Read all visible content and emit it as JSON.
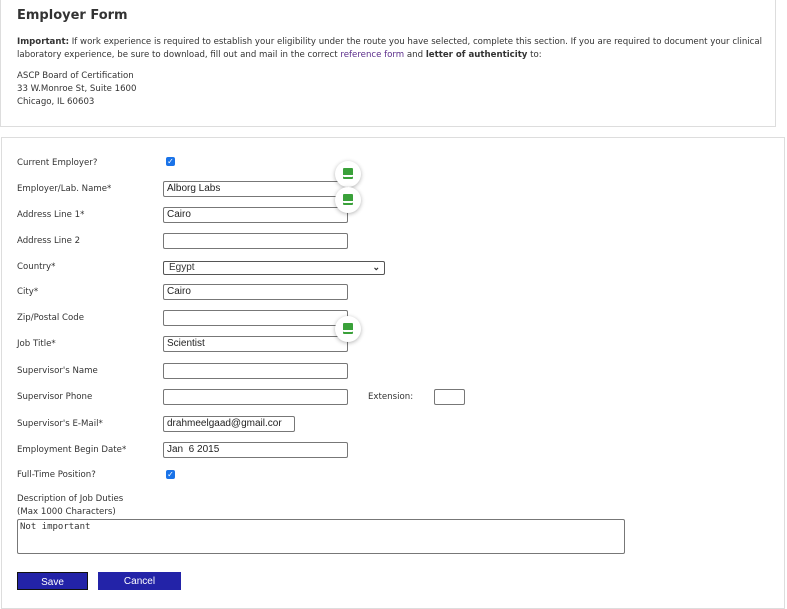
{
  "header": {
    "title": "Employer Form",
    "important_label": "Important:",
    "intro_1": " If work experience is required to establish your eligibility under the route you have selected, complete this section. If you are required to document your clinical laboratory experience, be sure to download, fill out and mail in the correct ",
    "reference_link": "reference form",
    "intro_2": " and ",
    "letter": "letter of authenticity",
    "intro_3": " to:",
    "address": [
      "ASCP Board of Certification",
      "33 W.Monroe St, Suite 1600",
      "Chicago, IL 60603"
    ]
  },
  "form": {
    "current_employer": {
      "label": "Current Employer?",
      "checked": true
    },
    "employer_name": {
      "label": "Employer/Lab. Name*",
      "value": "Alborg Labs"
    },
    "address1": {
      "label": "Address Line 1*",
      "value": "Cairo"
    },
    "address2": {
      "label": "Address Line 2",
      "value": ""
    },
    "country": {
      "label": "Country*",
      "value": "Egypt"
    },
    "city": {
      "label": "City*",
      "value": "Cairo"
    },
    "zip": {
      "label": "Zip/Postal Code",
      "value": ""
    },
    "job_title": {
      "label": "Job Title*",
      "value": "Scientist"
    },
    "supervisor_name": {
      "label": "Supervisor's Name",
      "value": ""
    },
    "supervisor_phone": {
      "label": "Supervisor Phone",
      "value": "",
      "extension_label": "Extension:",
      "extension": ""
    },
    "supervisor_email": {
      "label": "Supervisor's E-Mail*",
      "value": "drahmeelgaad@gmail.cor"
    },
    "begin_date": {
      "label": "Employment Begin Date*",
      "value": "Jan  6 2015"
    },
    "full_time": {
      "label": "Full-Time Position?",
      "checked": true
    },
    "duties": {
      "label": "Description of Job Duties",
      "sublabel": "(Max 1000 Characters)",
      "value": "Not important"
    },
    "check_glyph": "✓"
  },
  "buttons": {
    "save": "Save",
    "cancel": "Cancel"
  },
  "colors": {
    "button": "#2323a8",
    "checkbox": "#1a73e8",
    "link": "#5a2c8a",
    "extension_icon": "#3aa13a"
  }
}
